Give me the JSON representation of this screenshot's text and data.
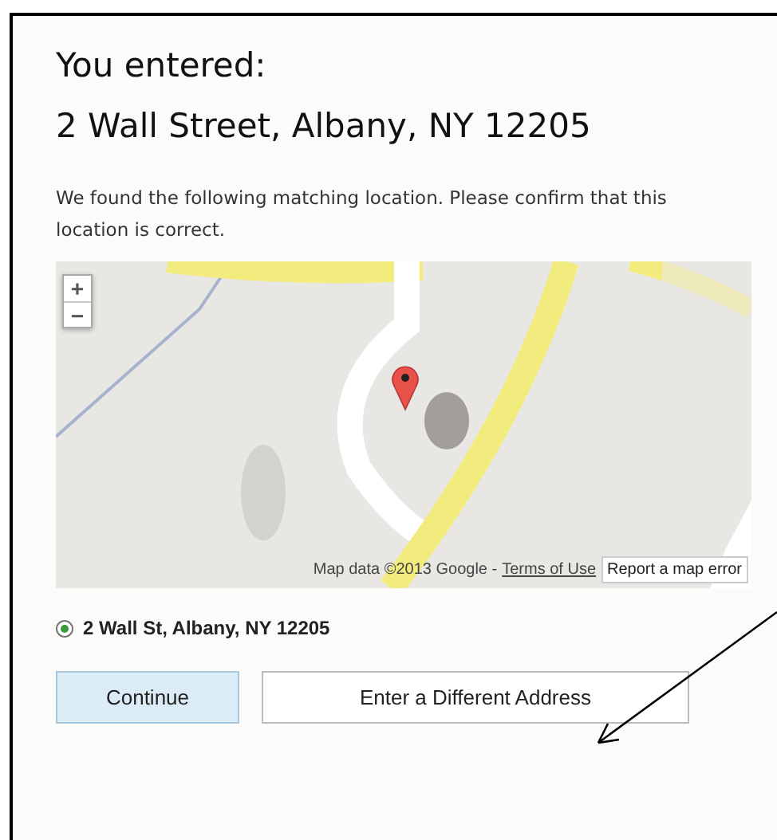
{
  "heading": {
    "label": "You entered:",
    "address": "2 Wall Street, Albany, NY 12205"
  },
  "message": "We found the following matching location. Please confirm that this location is correct.",
  "map": {
    "kind": "picture",
    "zoom_in": "+",
    "zoom_out": "−",
    "attribution": "Map data ©2013 Google -",
    "terms_link": "Terms of Use",
    "report_button": "Report a map error"
  },
  "locations": [
    {
      "label": "2 Wall St, Albany, NY 12205",
      "selected": true
    }
  ],
  "buttons": [
    {
      "label": "Continue",
      "kind": "primary"
    },
    {
      "label": "Enter a Different Address",
      "kind": "secondary"
    }
  ]
}
